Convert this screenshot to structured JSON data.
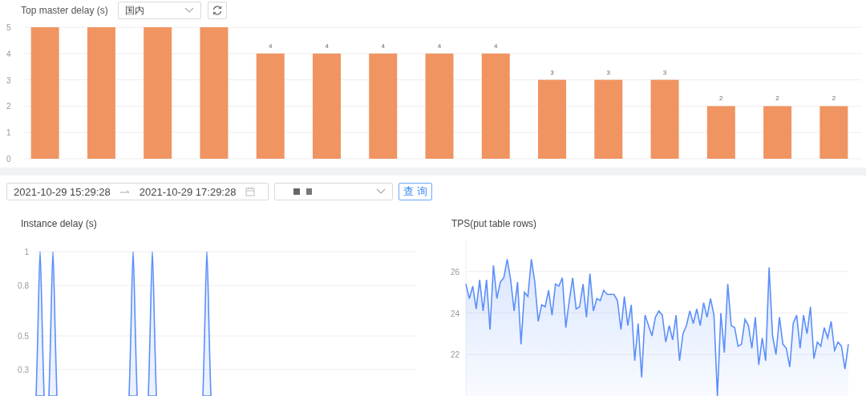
{
  "top_panel": {
    "title": "Top master delay (s)",
    "region_select": {
      "value": "国内"
    },
    "chart_data": {
      "type": "bar",
      "ylim": [
        0,
        5
      ],
      "yticks": [
        0,
        1,
        2,
        3,
        4,
        5
      ],
      "grid": true,
      "value_labels": [
        null,
        null,
        null,
        null,
        "4",
        "4",
        "4",
        "4",
        "4",
        "3",
        "3",
        "3",
        "2",
        "2",
        "2"
      ],
      "series": [
        {
          "color": "#f09462",
          "values": [
            5,
            5,
            5,
            5,
            4,
            4,
            4,
            4,
            4,
            3,
            3,
            3,
            2,
            2,
            2
          ]
        }
      ]
    }
  },
  "filters": {
    "start_time": "2021-10-29 15:29:28",
    "end_time": "2021-10-29 17:29:28",
    "query_button": "查 询"
  },
  "charts": [
    {
      "title": "Instance delay (s)",
      "y_axis_labels": [
        "1",
        "0.8",
        "0.5",
        "0.3"
      ]
    },
    {
      "title": "TPS(put table rows)",
      "chart_data": {
        "type": "area",
        "ylim": [
          20,
          27.5
        ],
        "yticks": [
          22,
          24,
          26
        ],
        "grid": true,
        "series": [
          {
            "color": "#5b8ff9",
            "values": [
              25.4,
              24.7,
              25.3,
              24.2,
              25.6,
              24.1,
              25.6,
              23.2,
              26.3,
              24.7,
              25.5,
              25.7,
              26.6,
              25.6,
              24.1,
              25.5,
              22.5,
              25,
              24.8,
              26.6,
              25.5,
              23.6,
              24.4,
              24.3,
              25.1,
              23.9,
              25.4,
              25.3,
              25.7,
              23.3,
              24.6,
              25.7,
              24.2,
              24.3,
              25.4,
              23.8,
              25.9,
              24.1,
              24.7,
              24.6,
              25.1,
              24.9,
              24.9,
              24.9,
              24.6,
              23.2,
              24.8,
              23.4,
              24.4,
              21.7,
              23.5,
              20.9,
              23.9,
              23.4,
              22.9,
              23.8,
              24.1,
              23.9,
              22.6,
              23.4,
              22.7,
              23.9,
              21.7,
              23,
              23.4,
              24.1,
              23.5,
              24.2,
              23.4,
              24.5,
              23.8,
              24.7,
              23.9,
              20,
              24,
              22.1,
              25.4,
              23.4,
              23.3,
              22.4,
              22.5,
              23.7,
              23.4,
              22.3,
              23.8,
              21.5,
              22.8,
              21.7,
              26.2,
              22.9,
              22,
              23.8,
              22.5,
              22.3,
              21.4,
              23.5,
              23.9,
              22.3,
              23.9,
              23,
              24.3,
              21.8,
              22.6,
              22.4,
              23.3,
              22.8,
              23.6,
              22.2,
              22.6,
              22.4,
              21.3,
              22.5
            ]
          }
        ]
      }
    }
  ]
}
